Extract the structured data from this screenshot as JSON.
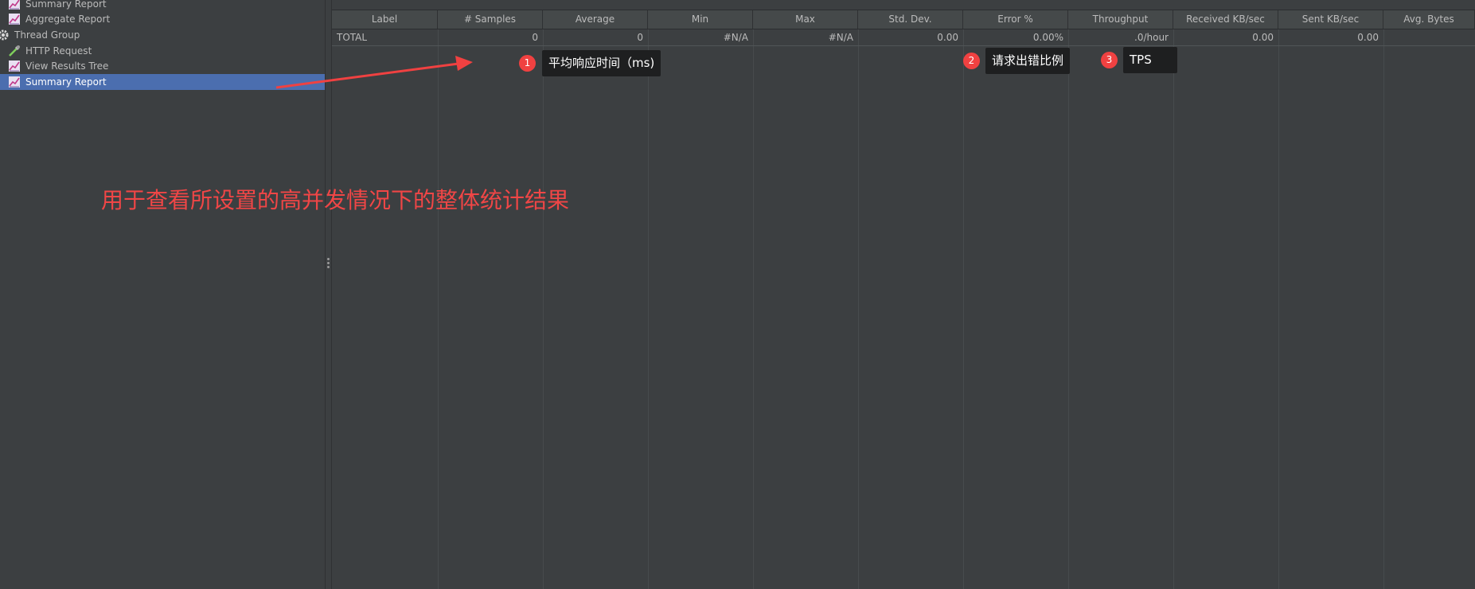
{
  "tree": {
    "items": [
      {
        "label": "Summary Report",
        "icon": "chart-report-icon",
        "selected": false
      },
      {
        "label": "Aggregate Report",
        "icon": "chart-report-icon",
        "selected": false
      },
      {
        "label": "Thread Group",
        "icon": "gear-icon",
        "selected": false
      },
      {
        "label": "HTTP Request",
        "icon": "pipette-icon",
        "selected": false
      },
      {
        "label": "View Results Tree",
        "icon": "chart-report-icon",
        "selected": false
      },
      {
        "label": "Summary Report",
        "icon": "chart-report-icon",
        "selected": true
      }
    ]
  },
  "table": {
    "columns": [
      "Label",
      "# Samples",
      "Average",
      "Min",
      "Max",
      "Std. Dev.",
      "Error %",
      "Throughput",
      "Received KB/sec",
      "Sent KB/sec",
      "Avg. Bytes"
    ],
    "rows": [
      [
        "TOTAL",
        "0",
        "0",
        "#N/A",
        "#N/A",
        "0.00",
        "0.00%",
        ".0/hour",
        "0.00",
        "0.00",
        ""
      ]
    ]
  },
  "annotations": {
    "callouts": [
      {
        "number": "1",
        "text": "平均响应时间（ms)"
      },
      {
        "number": "2",
        "text": "请求出错比例"
      },
      {
        "number": "3",
        "text": "TPS"
      }
    ],
    "caption": "用于查看所设置的高并发情况下的整体统计结果"
  },
  "colors": {
    "background": "#3c3f41",
    "selection": "#4b6eaf",
    "annotation_red": "#f04141",
    "callout_bg": "#1e1f20"
  }
}
